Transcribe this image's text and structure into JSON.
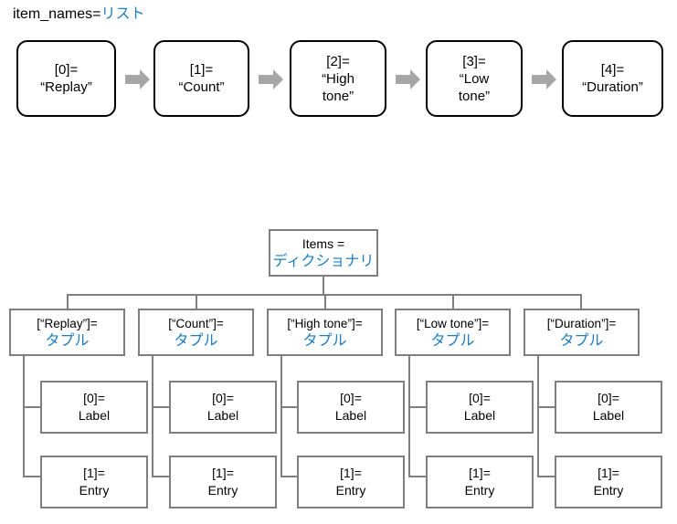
{
  "diagram": {
    "title_text": "item_names=",
    "title_type": "リスト",
    "list_items": [
      {
        "index": "[0]=",
        "value": "“Replay”"
      },
      {
        "index": "[1]=",
        "value": "“Count”"
      },
      {
        "index": "[2]=",
        "value": "“High tone”"
      },
      {
        "index": "[3]=",
        "value": "“Low tone”"
      },
      {
        "index": "[4]=",
        "value": "“Duration”"
      }
    ],
    "dictionary": {
      "name": "Items =",
      "type": "ディクショナリ"
    },
    "tuples": [
      {
        "key": "[“Replay”]=",
        "type": "タプル"
      },
      {
        "key": "[“Count”]=",
        "type": "タプル"
      },
      {
        "key": "[“High tone”]=",
        "type": "タプル"
      },
      {
        "key": "[“Low tone”]=",
        "type": "タプル"
      },
      {
        "key": "[“Duration”]=",
        "type": "タプル"
      }
    ],
    "tuple_members": [
      {
        "index": "[0]=",
        "value": "Label"
      },
      {
        "index": "[1]=",
        "value": "Entry"
      }
    ],
    "arrow_count": 4,
    "colors": {
      "accent_blue": "#1d7cc4",
      "box_outline_black": "#000000",
      "box_outline_grey": "#7f7f7f",
      "arrow_fill": "#a6a6a6",
      "background": "#ffffff"
    }
  }
}
